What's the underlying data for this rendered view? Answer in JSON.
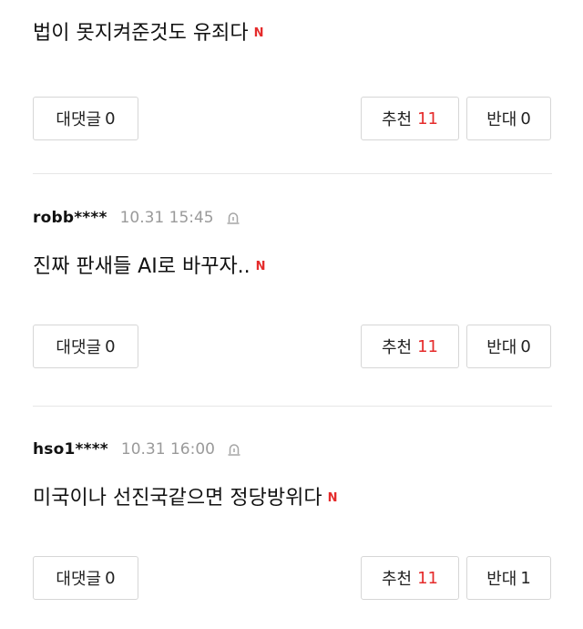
{
  "comments": [
    {
      "author": "",
      "time": "",
      "text": "법이 못지켜준것도 유죄다",
      "new_badge": "N",
      "reply_label": "대댓글",
      "reply_count": "0",
      "up_label": "추천",
      "up_count": "11",
      "down_label": "반대",
      "down_count": "0"
    },
    {
      "author": "robb****",
      "time": "10.31 15:45",
      "text": "진짜 판새들 AI로 바꾸자..",
      "new_badge": "N",
      "reply_label": "대댓글",
      "reply_count": "0",
      "up_label": "추천",
      "up_count": "11",
      "down_label": "반대",
      "down_count": "0"
    },
    {
      "author": "hso1****",
      "time": "10.31 16:00",
      "text": "미국이나 선진국같으면 정당방위다",
      "new_badge": "N",
      "reply_label": "대댓글",
      "reply_count": "0",
      "up_label": "추천",
      "up_count": "11",
      "down_label": "반대",
      "down_count": "1"
    }
  ],
  "colors": {
    "accent_red": "#e52b2b",
    "meta_gray": "#9a9a9a",
    "border": "#d6d6d6",
    "divider": "#e6e6e6"
  },
  "icons": {
    "report": "siren-icon",
    "new": "new-badge"
  }
}
